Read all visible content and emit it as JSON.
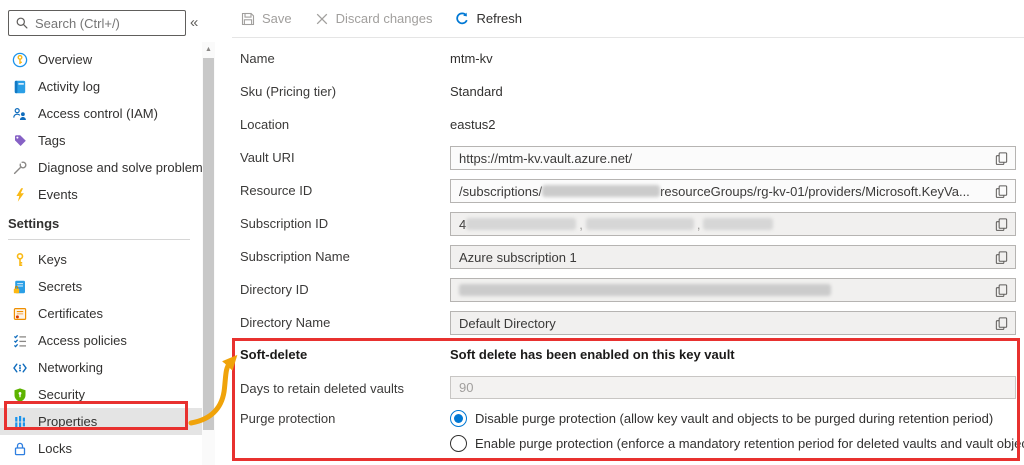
{
  "sidebar": {
    "search": {
      "placeholder": "Search (Ctrl+/)"
    },
    "collapse_glyph": "«",
    "items": [
      {
        "label": "Overview",
        "icon": "overview-icon"
      },
      {
        "label": "Activity log",
        "icon": "activity-log-icon"
      },
      {
        "label": "Access control (IAM)",
        "icon": "access-control-icon"
      },
      {
        "label": "Tags",
        "icon": "tag-icon"
      },
      {
        "label": "Diagnose and solve problems",
        "icon": "wrench-icon"
      },
      {
        "label": "Events",
        "icon": "lightning-icon"
      }
    ],
    "settings_header": "Settings",
    "settings_items": [
      {
        "label": "Keys",
        "icon": "key-icon"
      },
      {
        "label": "Secrets",
        "icon": "secret-icon"
      },
      {
        "label": "Certificates",
        "icon": "certificate-icon"
      },
      {
        "label": "Access policies",
        "icon": "checklist-icon"
      },
      {
        "label": "Networking",
        "icon": "networking-icon"
      },
      {
        "label": "Security",
        "icon": "shield-icon"
      },
      {
        "label": "Properties",
        "icon": "properties-icon",
        "selected": true
      },
      {
        "label": "Locks",
        "icon": "lock-icon"
      }
    ]
  },
  "toolbar": {
    "save": "Save",
    "discard": "Discard changes",
    "refresh": "Refresh"
  },
  "form": {
    "name": {
      "label": "Name",
      "value": "mtm-kv"
    },
    "sku": {
      "label": "Sku (Pricing tier)",
      "value": "Standard"
    },
    "location": {
      "label": "Location",
      "value": "eastus2"
    },
    "vault_uri": {
      "label": "Vault URI",
      "value": "https://mtm-kv.vault.azure.net/"
    },
    "resource_id": {
      "label": "Resource ID",
      "value_prefix": "/subscriptions/",
      "value_suffix": "resourceGroups/rg-kv-01/providers/Microsoft.KeyVa..."
    },
    "subscription_id": {
      "label": "Subscription ID",
      "value_prefix": "4",
      "separator": ","
    },
    "subscription_name": {
      "label": "Subscription Name",
      "value": "Azure subscription 1"
    },
    "directory_id": {
      "label": "Directory ID"
    },
    "directory_name": {
      "label": "Directory Name",
      "value": "Default Directory"
    },
    "soft_delete": {
      "label": "Soft-delete",
      "status": "Soft delete has been enabled on this key vault"
    },
    "retention": {
      "label": "Days to retain deleted vaults",
      "value": "90"
    },
    "purge": {
      "label": "Purge protection",
      "options": [
        {
          "label": "Disable purge protection (allow key vault and objects to be purged during retention period)",
          "selected": true
        },
        {
          "label": "Enable purge protection (enforce a mandatory retention period for deleted vaults and vault objects)",
          "selected": false
        }
      ]
    }
  },
  "colors": {
    "annotation_red": "#e8312f",
    "arrow_orange": "#f0a30a",
    "accent_blue": "#0078d4"
  }
}
